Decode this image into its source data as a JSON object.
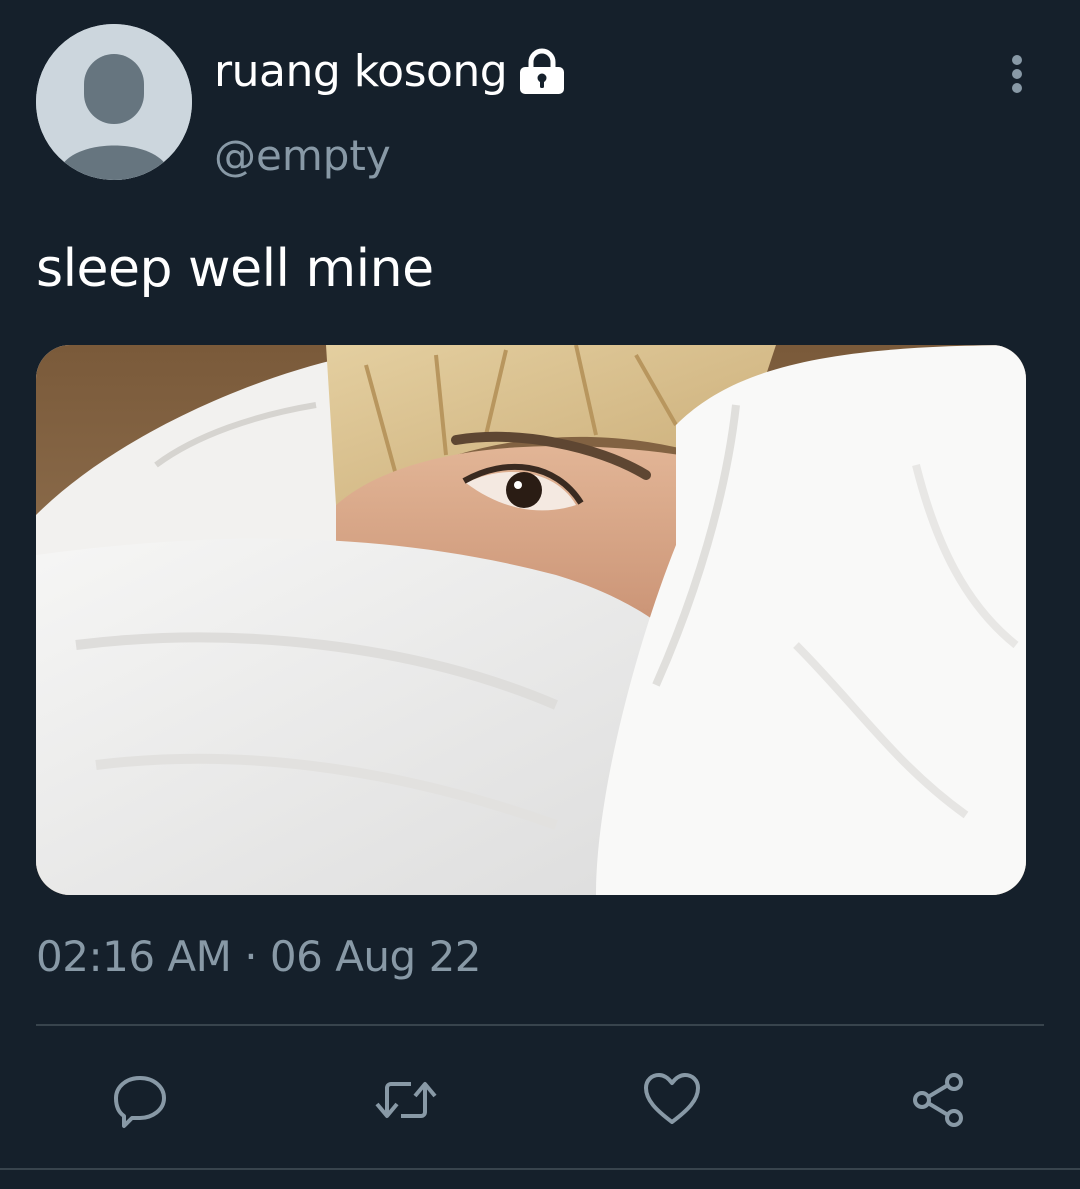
{
  "author": {
    "display_name": "ruang kosong",
    "handle": "@empty",
    "protected_icon": "lock-icon",
    "avatar_icon": "default-avatar-icon"
  },
  "tweet": {
    "text": "sleep well mine",
    "timestamp": "02:16 AM · 06 Aug 22",
    "media_description_icon": "photo"
  },
  "actions": [
    {
      "icon": "reply-icon"
    },
    {
      "icon": "retweet-icon"
    },
    {
      "icon": "like-icon"
    },
    {
      "icon": "share-icon"
    }
  ],
  "colors": {
    "background": "#15202b",
    "primary_text": "#ffffff",
    "secondary_text": "#8899a6",
    "divider": "#38444d"
  }
}
